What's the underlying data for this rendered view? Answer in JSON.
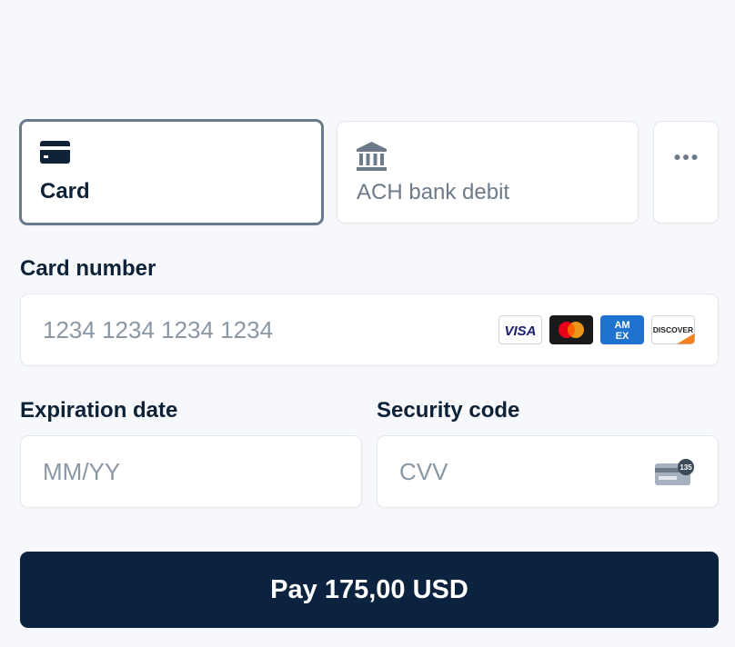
{
  "tabs": {
    "card": {
      "label": "Card",
      "icon": "credit-card-icon",
      "active": true
    },
    "ach": {
      "label": "ACH bank debit",
      "icon": "bank-icon",
      "active": false
    },
    "more": {
      "icon": "more-dots-icon"
    }
  },
  "card_number": {
    "label": "Card number",
    "placeholder": "1234 1234 1234 1234",
    "value": "",
    "brands": [
      "VISA",
      "mastercard",
      "AMEX",
      "DISCOVER"
    ]
  },
  "expiry": {
    "label": "Expiration date",
    "placeholder": "MM/YY",
    "value": ""
  },
  "security": {
    "label": "Security code",
    "placeholder": "CVV",
    "value": "",
    "icon_text": "135"
  },
  "pay_button": {
    "label": "Pay 175,00 USD"
  },
  "colors": {
    "accent": "#0c2340",
    "active_border": "#6a7a8c",
    "placeholder": "#8a97a5",
    "background": "#f6f8fb"
  }
}
